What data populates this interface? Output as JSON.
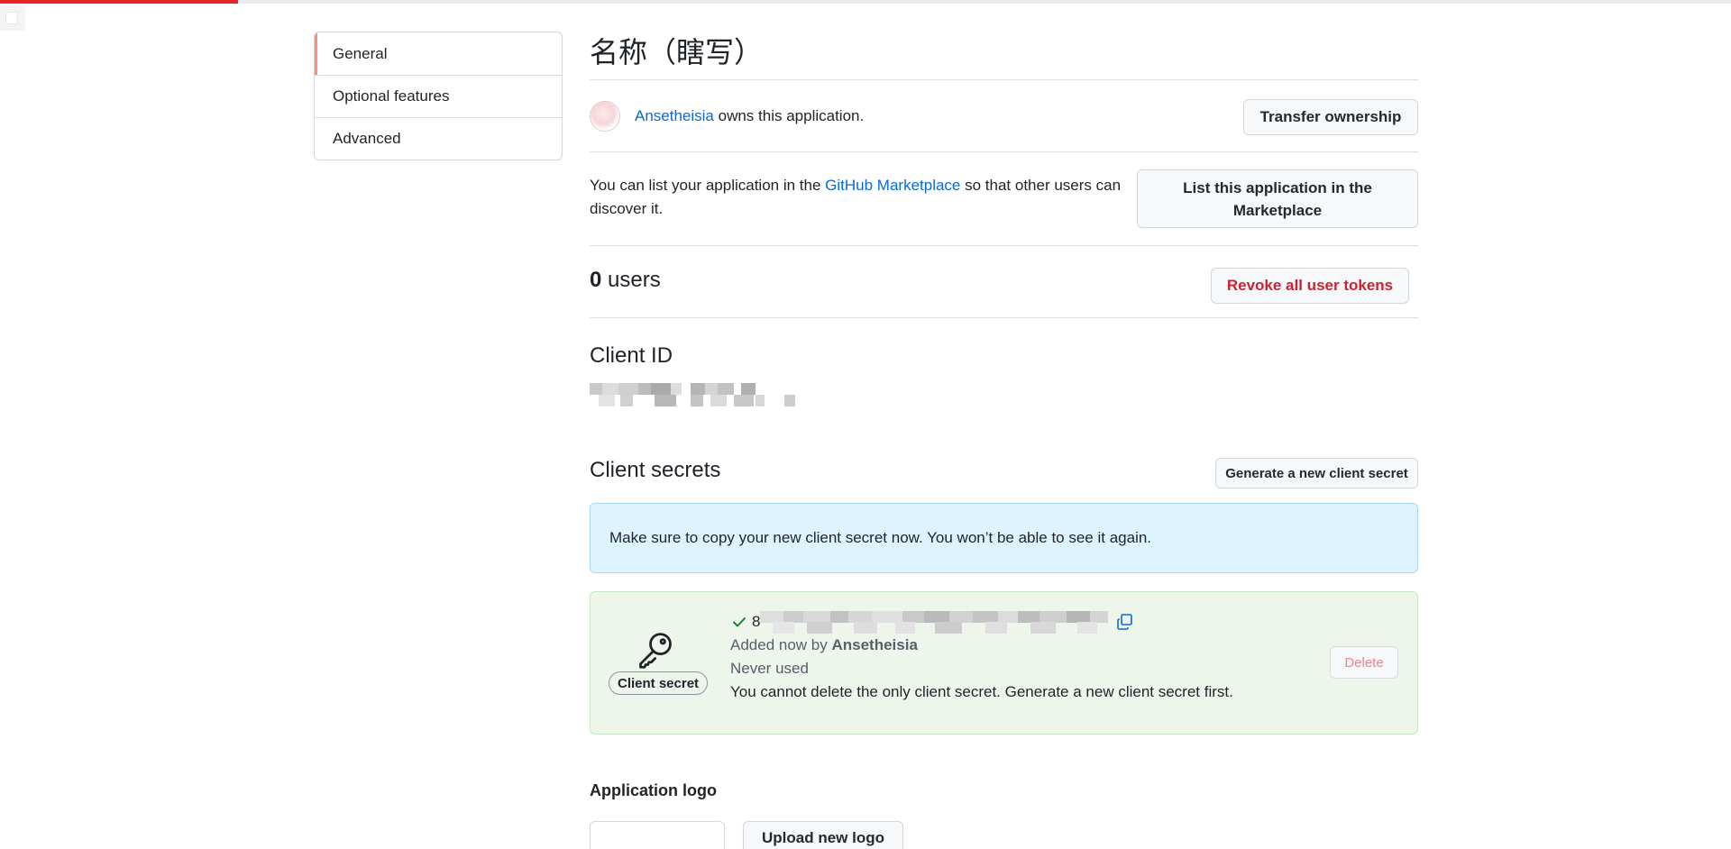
{
  "page_title": "名称（瞎写）",
  "sidebar": {
    "items": [
      {
        "label": "General",
        "active": true
      },
      {
        "label": "Optional features",
        "active": false
      },
      {
        "label": "Advanced",
        "active": false
      }
    ]
  },
  "owner": {
    "name": "Ansetheisia",
    "suffix": " owns this application.",
    "transfer_label": "Transfer ownership"
  },
  "marketplace": {
    "text_before": "You can list your application in the ",
    "link_text": "GitHub Marketplace",
    "text_after": " so that other users can discover it.",
    "button_label": "List this application in the Marketplace"
  },
  "users": {
    "count": "0",
    "label": " users",
    "revoke_label": "Revoke all user tokens"
  },
  "client_id": {
    "heading": "Client ID"
  },
  "client_secrets": {
    "heading": "Client secrets",
    "generate_label": "Generate a new client secret",
    "flash_message": "Make sure to copy your new client secret now. You won’t be able to see it again.",
    "secret": {
      "badge_label": "Client secret",
      "value_prefix": "8",
      "added_prefix": "Added now by ",
      "added_by": "Ansetheisia",
      "usage": "Never used",
      "note": "You cannot delete the only client secret. Generate a new client secret first.",
      "delete_label": "Delete"
    }
  },
  "application_logo": {
    "heading": "Application logo",
    "upload_label": "Upload new logo"
  },
  "colors": {
    "accent_link": "#0969da",
    "danger": "#cf222e",
    "progress": "#e5252a",
    "sidebar_active": "#fd8c73",
    "info_bg": "#ddf4ff",
    "success_bg": "#eef6ec"
  },
  "icons": {
    "key": "key-icon",
    "check": "check-icon",
    "copy": "copy-icon"
  },
  "progress": {
    "fraction": 0.1375
  }
}
